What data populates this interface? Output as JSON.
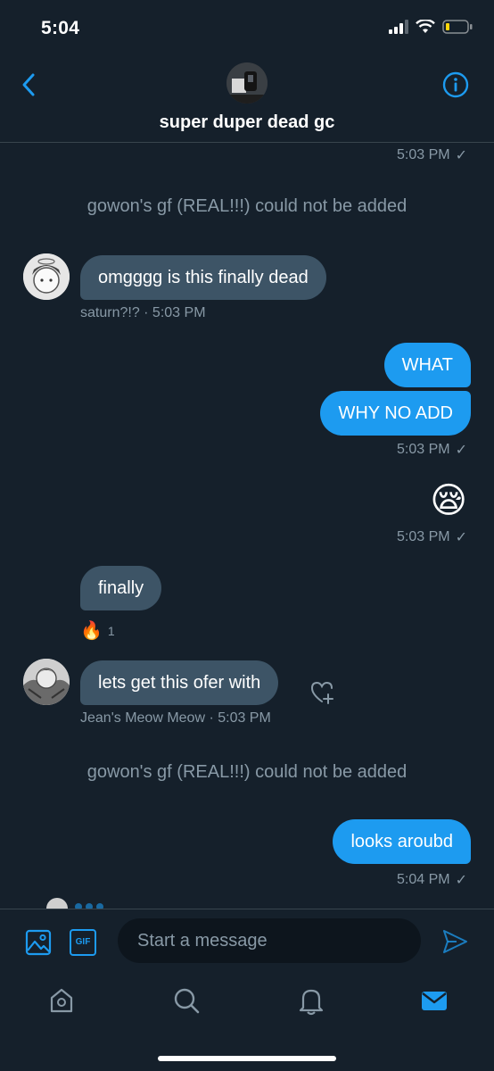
{
  "status": {
    "time": "5:04"
  },
  "header": {
    "title": "super duper dead gc"
  },
  "messages": {
    "top_time": "5:03 PM",
    "sys1": "gowon's gf (REAL!!!) could not be added",
    "in1_text": "omgggg is this finally dead",
    "in1_meta": "saturn?!? · 5:03 PM",
    "out1_text": "WHAT",
    "out2_text": "WHY NO ADD",
    "out_time1": "5:03 PM",
    "emoji": "😪",
    "out_time2": "5:03 PM",
    "in2_text": "finally",
    "reaction_emoji": "🔥",
    "reaction_count": "1",
    "in3_text": "lets get this ofer with",
    "in3_meta": "Jean's Meow Meow · 5:03 PM",
    "sys2": "gowon's gf (REAL!!!) could not be added",
    "out3_text": "looks aroubd",
    "out_time3": "5:04 PM",
    "check": "✓"
  },
  "composer": {
    "placeholder": "Start a message",
    "gif_label": "GIF"
  },
  "colors": {
    "background": "#15202b",
    "accent": "#1d9bf0",
    "incoming_bubble": "#3d5466",
    "muted": "#8899a6"
  },
  "icons": [
    "back-icon",
    "info-icon",
    "image-icon",
    "gif-icon",
    "send-icon",
    "home-icon",
    "search-icon",
    "bell-icon",
    "mail-icon",
    "heart-plus-icon"
  ]
}
